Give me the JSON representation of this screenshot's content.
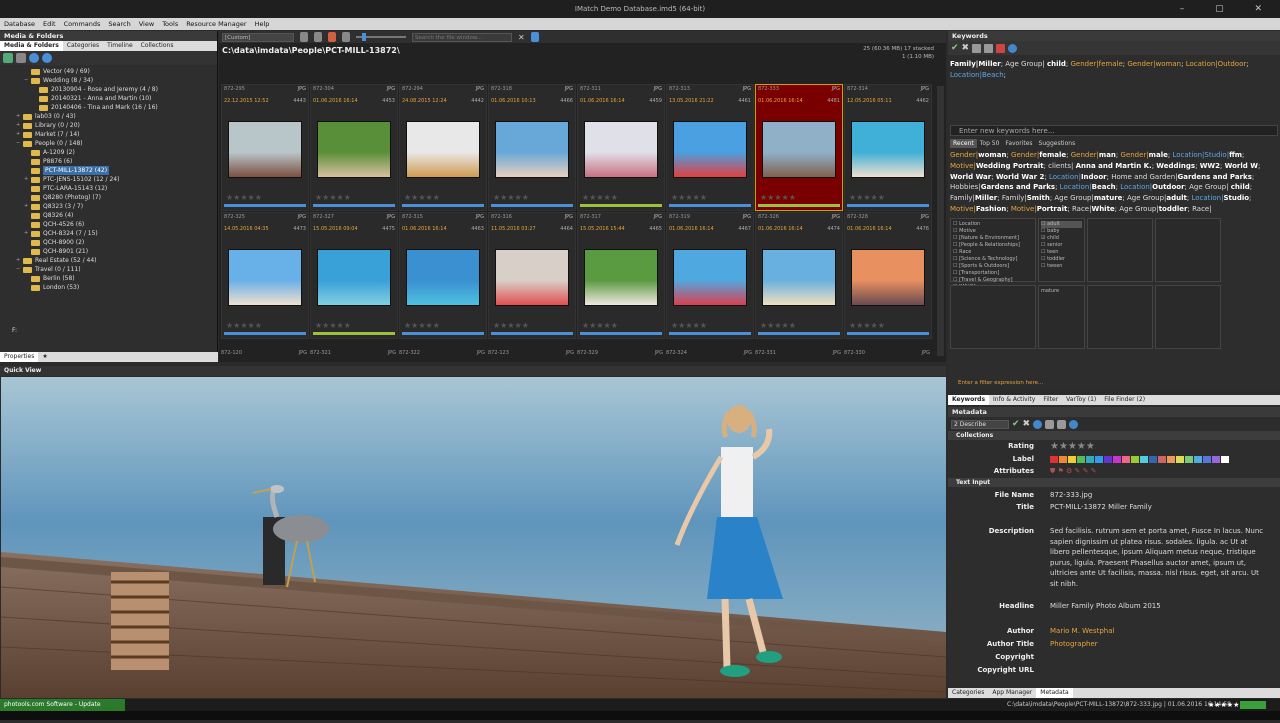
{
  "window": {
    "title": "IMatch Demo Database.imd5 (64-bit)"
  },
  "menu": [
    "Database",
    "Edit",
    "Commands",
    "Search",
    "View",
    "Tools",
    "Resource Manager",
    "Help"
  ],
  "left": {
    "panel_title": "Media & Folders",
    "tabs": [
      "Media & Folders",
      "Categories",
      "Timeline",
      "Collections"
    ],
    "tree": [
      {
        "label": "Vector (49 / 69)",
        "indent": 2
      },
      {
        "label": "Wedding (8 / 34)",
        "indent": 2,
        "exp": "−"
      },
      {
        "label": "20130904 - Rose and Jeremy (4 / 8)",
        "indent": 3
      },
      {
        "label": "20140321 - Anna and Martin (10)",
        "indent": 3
      },
      {
        "label": "20140406 - Tina and Mark (16 / 16)",
        "indent": 3
      },
      {
        "label": "lab03 (0 / 43)",
        "indent": 1,
        "exp": "+"
      },
      {
        "label": "Library (0 / 20)",
        "indent": 1,
        "exp": "+"
      },
      {
        "label": "Market (7 / 14)",
        "indent": 1,
        "exp": "+"
      },
      {
        "label": "People (0 / 148)",
        "indent": 1,
        "exp": "−"
      },
      {
        "label": "A-1209 (2)",
        "indent": 2
      },
      {
        "label": "P8876 (6)",
        "indent": 2
      },
      {
        "label": "PCT-MILL-13872 (42)",
        "indent": 2,
        "sel": true
      },
      {
        "label": "PTC-JENS-15102 (12 / 24)",
        "indent": 2,
        "exp": "+"
      },
      {
        "label": "PTC-LARA-15143 (12)",
        "indent": 2
      },
      {
        "label": "Q8280 (Photog) (7)",
        "indent": 2
      },
      {
        "label": "Q8323 (3 / 7)",
        "indent": 2,
        "exp": "+"
      },
      {
        "label": "Q8326 (4)",
        "indent": 2
      },
      {
        "label": "QCH-4526 (6)",
        "indent": 2
      },
      {
        "label": "QCH-8324 (7 / 15)",
        "indent": 2,
        "exp": "+"
      },
      {
        "label": "QCH-8900 (2)",
        "indent": 2
      },
      {
        "label": "QCH-8901 (21)",
        "indent": 2
      },
      {
        "label": "Real Estate (52 / 44)",
        "indent": 1,
        "exp": "+"
      },
      {
        "label": "Travel (0 / 111)",
        "indent": 1,
        "exp": "−"
      },
      {
        "label": "Berlin (58)",
        "indent": 2
      },
      {
        "label": "London (53)",
        "indent": 2
      }
    ],
    "drive": "F:",
    "bottom_tabs": [
      "Properties",
      "★"
    ]
  },
  "center": {
    "view_combo": "[Custom]",
    "search_placeholder": "Search the file window...",
    "path": "C:\\data\\imdata\\People\\PCT-MILL-13872\\",
    "stats_line1": "25 (60.36 MB) 17 stacked",
    "stats_line2": "1 (1.10 MB)",
    "rows": [
      [
        {
          "fn": "872-295",
          "ext": "JPG",
          "dt": "22.12.2015 12:52",
          "sz": "4443",
          "c1": "#b9c6c9",
          "c2": "#7a5040",
          "bar": "b"
        },
        {
          "fn": "872-304",
          "ext": "JPG",
          "dt": "01.06.2016 16:14",
          "sz": "4453",
          "c1": "#5a8f3a",
          "c2": "#d8c0a0",
          "bar": "b"
        },
        {
          "fn": "872-294",
          "ext": "JPG",
          "dt": "24.08.2015 12:24",
          "sz": "4442",
          "c1": "#e8e8e8",
          "c2": "#d09a50",
          "bar": "b"
        },
        {
          "fn": "872-318",
          "ext": "JPG",
          "dt": "01.06.2016 10:13",
          "sz": "4466",
          "c1": "#68a8d8",
          "c2": "#e8d0c0",
          "bar": "b"
        },
        {
          "fn": "872-311",
          "ext": "JPG",
          "dt": "01.06.2016 16:14",
          "sz": "4459",
          "c1": "#e0e0e8",
          "c2": "#c87080",
          "bar": "g"
        },
        {
          "fn": "872-313",
          "ext": "JPG",
          "dt": "13.05.2016 21:22",
          "sz": "4461",
          "c1": "#4aa0e0",
          "c2": "#e04040",
          "bar": "b"
        },
        {
          "fn": "872-333",
          "ext": "JPG",
          "dt": "01.06.2016 16:14",
          "sz": "4481",
          "c1": "#90b0c8",
          "c2": "#806050",
          "bar": "g",
          "sel": true
        },
        {
          "fn": "872-314",
          "ext": "JPG",
          "dt": "12.05.2016 05:11",
          "sz": "4462",
          "c1": "#40b0d8",
          "c2": "#f0e0d0",
          "bar": "b"
        }
      ],
      [
        {
          "fn": "872-325",
          "ext": "JPG",
          "dt": "14.05.2016 04:35",
          "sz": "4473",
          "c1": "#68b0e8",
          "c2": "#f0e0d0",
          "bar": "b"
        },
        {
          "fn": "872-327",
          "ext": "JPG",
          "dt": "15.05.2016 09:04",
          "sz": "4475",
          "c1": "#3aa0d8",
          "c2": "#80d0e0",
          "bar": "g"
        },
        {
          "fn": "872-315",
          "ext": "JPG",
          "dt": "01.06.2016 16:14",
          "sz": "4463",
          "c1": "#3a90d0",
          "c2": "#50c0e0",
          "bar": "b"
        },
        {
          "fn": "872-316",
          "ext": "JPG",
          "dt": "11.05.2016 03:27",
          "sz": "4464",
          "c1": "#d8d0c8",
          "c2": "#e05050",
          "bar": "b"
        },
        {
          "fn": "872-317",
          "ext": "JPG",
          "dt": "15.05.2016 15:44",
          "sz": "4465",
          "c1": "#5a9a40",
          "c2": "#f0e8e0",
          "bar": "b"
        },
        {
          "fn": "872-319",
          "ext": "JPG",
          "dt": "01.06.2016 16:14",
          "sz": "4467",
          "c1": "#50a8e0",
          "c2": "#d84050",
          "bar": "b"
        },
        {
          "fn": "872-326",
          "ext": "JPG",
          "dt": "01.06.2016 16:14",
          "sz": "4474",
          "c1": "#68b0e0",
          "c2": "#f0e0c0",
          "bar": "b"
        },
        {
          "fn": "872-328",
          "ext": "JPG",
          "dt": "01.06.2016 16:14",
          "sz": "4476",
          "c1": "#e89060",
          "c2": "#6a4a50",
          "bar": "b"
        }
      ]
    ],
    "partial_row": [
      {
        "fn": "872-120",
        "ext": "JPG"
      },
      {
        "fn": "872-321",
        "ext": "JPG"
      },
      {
        "fn": "872-322",
        "ext": "JPG"
      },
      {
        "fn": "872-123",
        "ext": "JPG"
      },
      {
        "fn": "872-329",
        "ext": "JPG"
      },
      {
        "fn": "872-324",
        "ext": "JPG"
      },
      {
        "fn": "872-331",
        "ext": "JPG"
      },
      {
        "fn": "872-330",
        "ext": "JPG"
      }
    ]
  },
  "quick_view": {
    "title": "Quick View"
  },
  "keywords": {
    "panel_title": "Keywords",
    "input_placeholder": "Enter new keywords here...",
    "tabs": [
      "Recent",
      "Top 50",
      "Favorites",
      "Suggestions"
    ],
    "filter_placeholder": "Enter a filter expression here...",
    "facet1": [
      "Location",
      "Motive",
      "[Nature & Environment]",
      "[People & Relationships]",
      "Race",
      "[Science & Technology]",
      "[Sports & Outdoors]",
      "[Transportation]",
      "[Travel & Geography]",
      "[WHO]",
      "World War 2"
    ],
    "facet2": [
      "adult",
      "baby",
      "child",
      "senior",
      "teen",
      "toddler",
      "tween"
    ],
    "facet_mature": "mature"
  },
  "right_tabs": [
    "Keywords",
    "Info & Activity",
    "Filter",
    "VarToy (1)",
    "File Finder (2)"
  ],
  "metadata": {
    "panel_title": "Metadata",
    "combo": "2 Describe",
    "sec_collections": "Collections",
    "sec_text": "Text Input",
    "rating_label": "Rating",
    "label_label": "Label",
    "attributes_label": "Attributes",
    "filename_label": "File Name",
    "filename": "872-333.jpg",
    "title_label": "Title",
    "title": "PCT-MILL-13872 Miller Family",
    "description_label": "Description",
    "description": "Sed facilisis. rutrum sem et porta amet, Fusce In lacus. Nunc sapien dignissim ut platea risus. sodales. ligula. ac Ut at libero pellentesque, ipsum Aliquam metus neque, tristique purus, ligula. Praesent Phasellus auctor amet, ipsum ut, ultricies ante Ut facilisis, massa. nisl risus. eget, sit arcu. Ut sit nibh.",
    "headline_label": "Headline",
    "headline": "Miller Family Photo Album 2015",
    "author_label": "Author",
    "author": "Mario M. Westphal",
    "author_title_label": "Author Title",
    "author_title": "Photographer",
    "copyright_label": "Copyright",
    "copyright_url_label": "Copyright URL",
    "bottom_tabs": [
      "Categories",
      "App Manager",
      "Metadata"
    ],
    "swatches": [
      "#d33",
      "#e83",
      "#ec3",
      "#5b5",
      "#3ab",
      "#39e",
      "#63c",
      "#c3c",
      "#e68",
      "#9c3",
      "#5cd",
      "#36a",
      "#c66",
      "#e95",
      "#dd5",
      "#7c7",
      "#5ad",
      "#57d",
      "#96d",
      "#fff"
    ]
  },
  "status": {
    "update": "photools.com Software - Update available.",
    "filepath": "C:\\data\\imdata\\People\\PCT-MILL-13872\\872-333.jpg | 01.06.2016 16:14:58",
    "stars": "★★★★★"
  }
}
